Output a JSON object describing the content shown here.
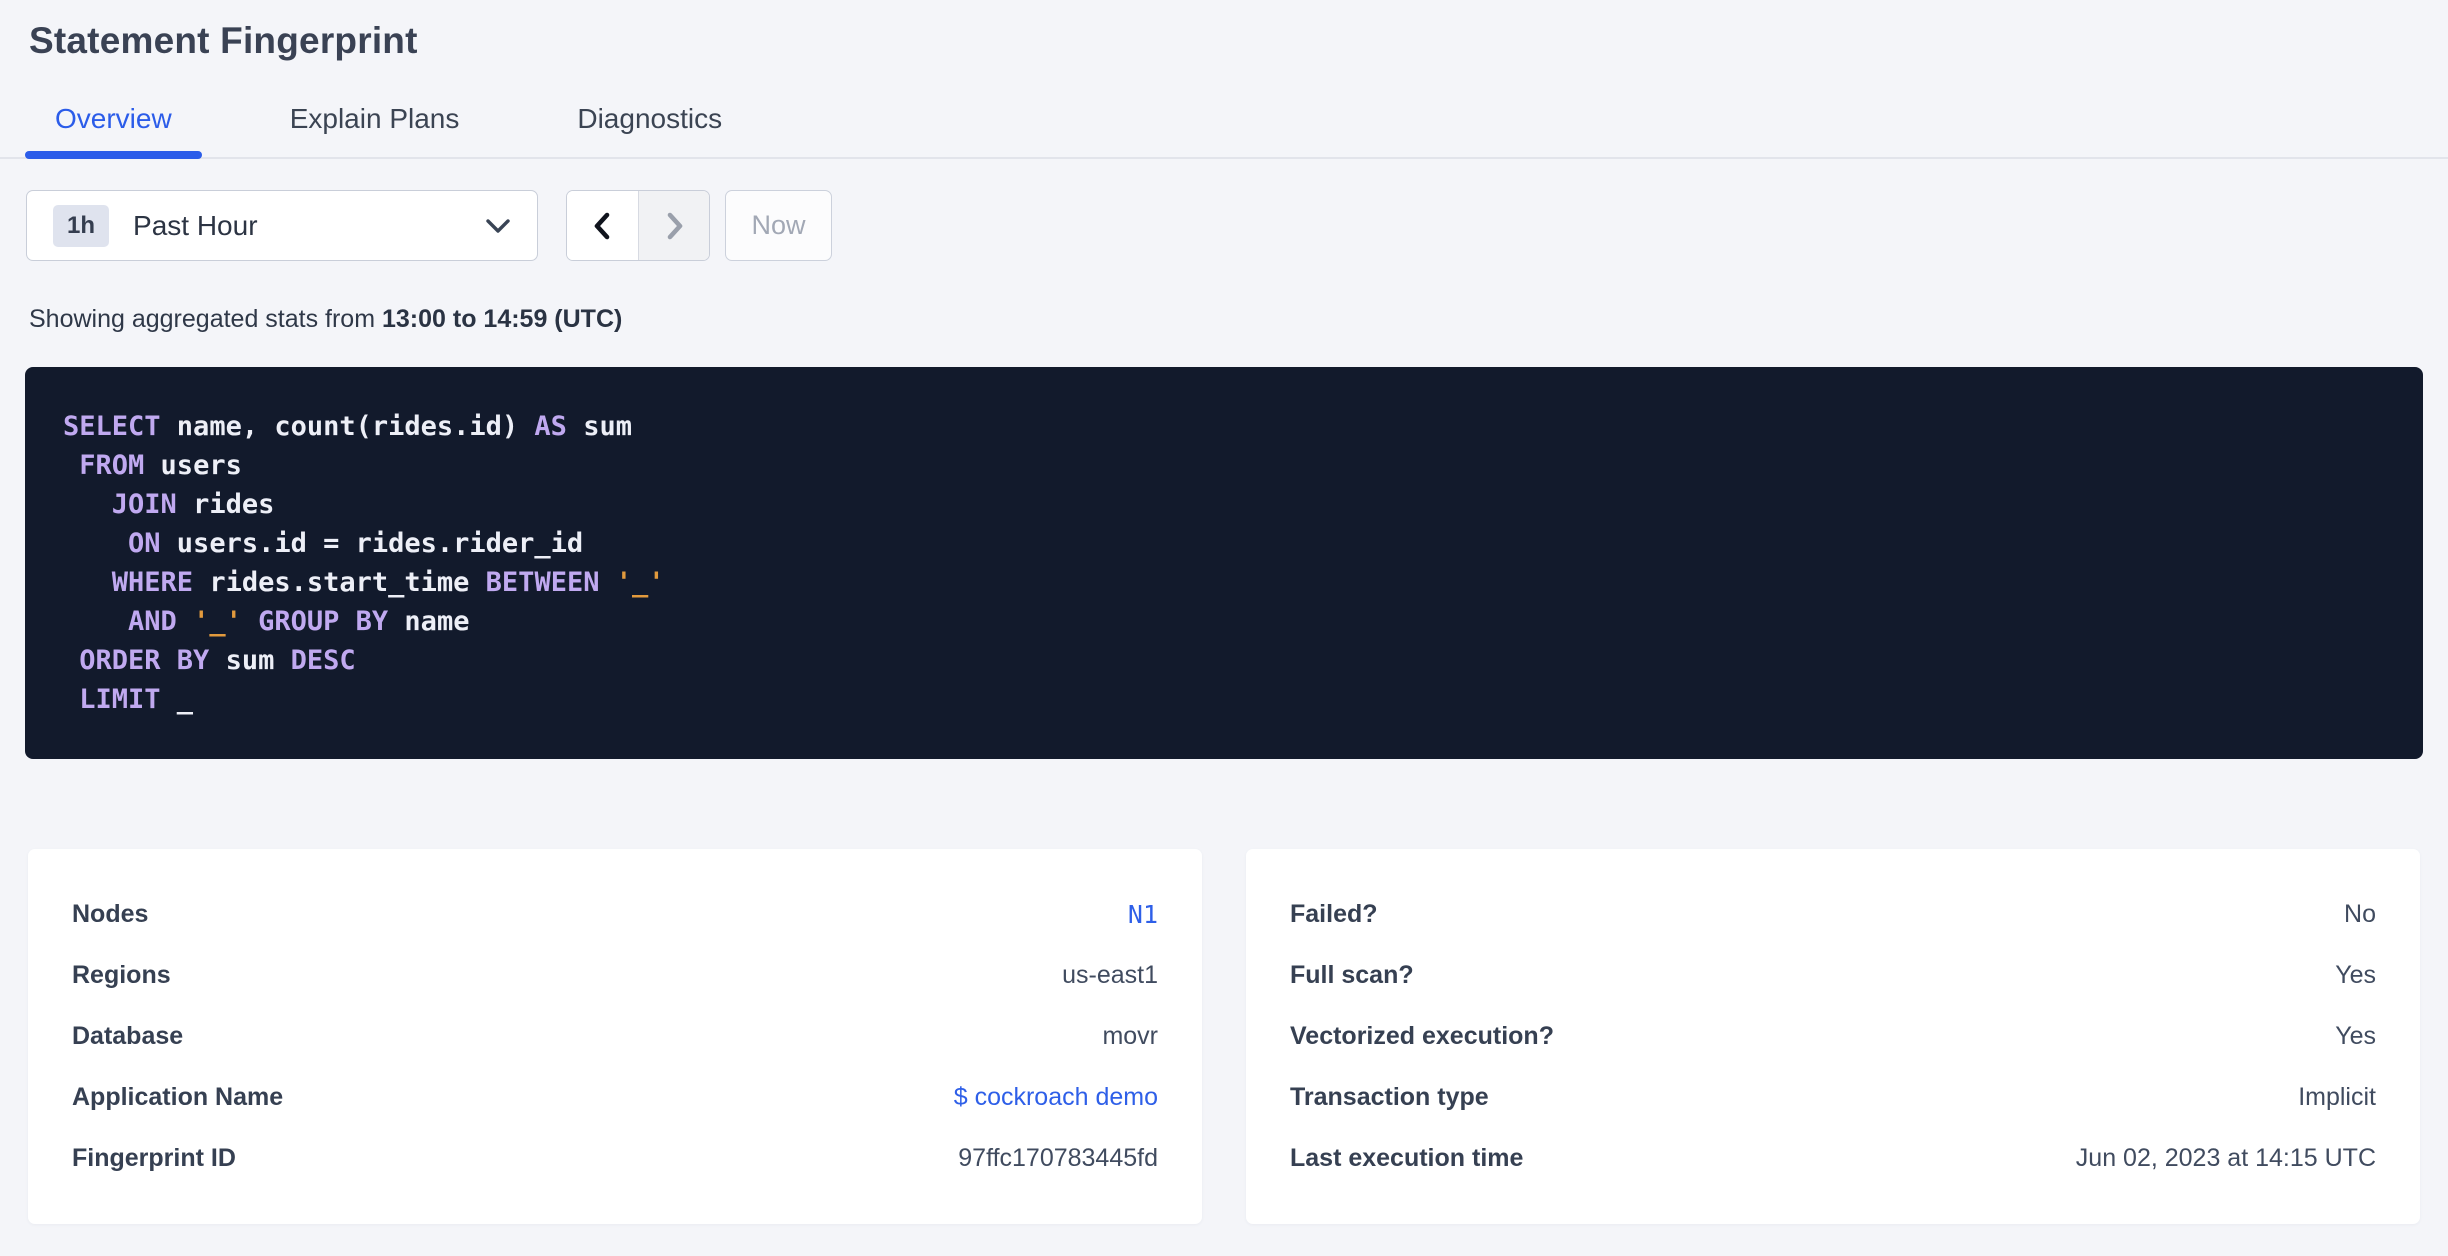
{
  "page": {
    "title": "Statement Fingerprint"
  },
  "tabs": [
    {
      "label": "Overview",
      "active": true
    },
    {
      "label": "Explain Plans",
      "active": false
    },
    {
      "label": "Diagnostics",
      "active": false
    }
  ],
  "time_picker": {
    "badge": "1h",
    "label": "Past Hour",
    "now_label": "Now",
    "prev_icon": "chevron-left",
    "next_icon": "chevron-right",
    "dropdown_icon": "chevron-down"
  },
  "stats_caption": {
    "prefix": "Showing aggregated stats from ",
    "range": "13:00 to 14:59 (UTC)"
  },
  "sql": {
    "lines": [
      [
        [
          "SELECT",
          "k"
        ],
        [
          " name, count(rides.id) ",
          "p"
        ],
        [
          "AS",
          "k"
        ],
        [
          " sum",
          "p"
        ]
      ],
      [
        [
          " ",
          "p"
        ],
        [
          "FROM",
          "k"
        ],
        [
          " users",
          "p"
        ]
      ],
      [
        [
          "   ",
          "p"
        ],
        [
          "JOIN",
          "k"
        ],
        [
          " rides",
          "p"
        ]
      ],
      [
        [
          "    ",
          "p"
        ],
        [
          "ON",
          "k"
        ],
        [
          " users.id = rides.rider_id",
          "p"
        ]
      ],
      [
        [
          "   ",
          "p"
        ],
        [
          "WHERE",
          "k"
        ],
        [
          " rides.start_time ",
          "p"
        ],
        [
          "BETWEEN",
          "k"
        ],
        [
          " ",
          "p"
        ],
        [
          "'_'",
          "l"
        ]
      ],
      [
        [
          "    ",
          "p"
        ],
        [
          "AND",
          "k"
        ],
        [
          " ",
          "p"
        ],
        [
          "'_'",
          "l"
        ],
        [
          " ",
          "p"
        ],
        [
          "GROUP BY",
          "k"
        ],
        [
          " name",
          "p"
        ]
      ],
      [
        [
          " ",
          "p"
        ],
        [
          "ORDER BY",
          "k"
        ],
        [
          " sum ",
          "p"
        ],
        [
          "DESC",
          "k"
        ]
      ],
      [
        [
          " ",
          "p"
        ],
        [
          "LIMIT",
          "k"
        ],
        [
          " _",
          "p"
        ]
      ]
    ]
  },
  "cards": [
    {
      "rows": [
        {
          "label": "Nodes",
          "value": "N1",
          "link": true,
          "mono": true
        },
        {
          "label": "Regions",
          "value": "us-east1"
        },
        {
          "label": "Database",
          "value": "movr"
        },
        {
          "label": "Application Name",
          "value": "$ cockroach demo",
          "link": true
        },
        {
          "label": "Fingerprint ID",
          "value": "97ffc170783445fd"
        }
      ]
    },
    {
      "rows": [
        {
          "label": "Failed?",
          "value": "No"
        },
        {
          "label": "Full scan?",
          "value": "Yes"
        },
        {
          "label": "Vectorized execution?",
          "value": "Yes"
        },
        {
          "label": "Transaction type",
          "value": "Implicit"
        },
        {
          "label": "Last execution time",
          "value": "Jun 02, 2023 at 14:15 UTC"
        }
      ]
    }
  ],
  "colors": {
    "page_background": "#f4f5f9",
    "accent_blue": "#2b5ce9",
    "link_blue": "#2e5fe8",
    "code_background": "#121a2c",
    "code_keyword": "#c0a9f0",
    "code_plain": "#edeff7",
    "code_literal": "#e29a3d",
    "text_dark": "#3a4254",
    "disabled_text": "#a2a8b5"
  }
}
